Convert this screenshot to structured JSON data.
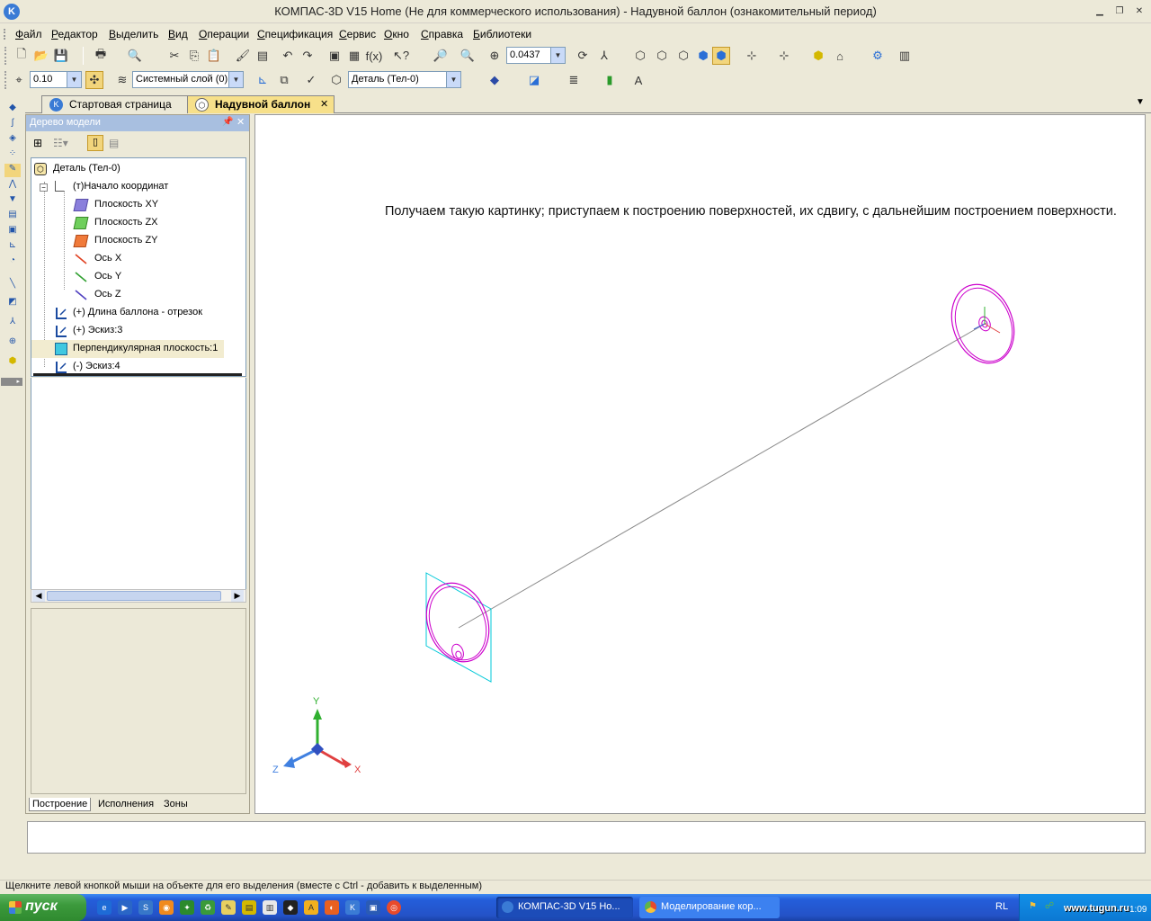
{
  "window": {
    "title": "КОМПАС-3D V15 Home (Не для коммерческого использования) - Надувной баллон (ознакомительный период)",
    "app_icon": "kompas-logo-icon"
  },
  "menu": [
    "Файл",
    "Редактор",
    "Выделить",
    "Вид",
    "Операции",
    "Спецификация",
    "Сервис",
    "Окно",
    "Справка",
    "Библиотеки"
  ],
  "toolbar": {
    "zoom_value": "0.0437",
    "step_value": "0.10",
    "layer_value": "Системный слой (0)",
    "detail_value": "Деталь (Тел-0)"
  },
  "tabs": [
    {
      "label": "Стартовая страница",
      "active": false
    },
    {
      "label": "Надувной баллон",
      "active": true
    }
  ],
  "tree_panel": {
    "title": "Дерево модели",
    "items": [
      {
        "label": "Деталь (Тел-0)",
        "icon": "part-icon"
      },
      {
        "label": "(т)Начало координат",
        "icon": "origin-icon"
      },
      {
        "label": "Плоскость XY",
        "icon": "plane-xy-icon"
      },
      {
        "label": "Плоскость ZX",
        "icon": "plane-zx-icon"
      },
      {
        "label": "Плоскость ZY",
        "icon": "plane-zy-icon"
      },
      {
        "label": "Ось X",
        "icon": "axis-x-icon"
      },
      {
        "label": "Ось Y",
        "icon": "axis-y-icon"
      },
      {
        "label": "Ось Z",
        "icon": "axis-z-icon"
      },
      {
        "label": "(+) Длина баллона - отрезок",
        "icon": "sketch-icon"
      },
      {
        "label": "(+) Эскиз:3",
        "icon": "sketch-icon"
      },
      {
        "label": "Перпендикулярная плоскость:1",
        "icon": "plane-icon"
      },
      {
        "label": "(-) Эскиз:4",
        "icon": "sketch-icon"
      }
    ],
    "bottom_tabs": [
      "Построение",
      "Исполнения",
      "Зоны"
    ]
  },
  "viewport": {
    "annotation": "Получаем такую картинку; приступаем к построению поверхностей, их сдвигу, с дальнейшим построением поверхности.",
    "axis_labels": {
      "x": "X",
      "y": "Y",
      "z": "Z"
    },
    "colors": {
      "sketch": "#cc00cc",
      "plane": "#00c8d8",
      "line": "#8a8a8a"
    }
  },
  "statusbar": {
    "text": "Щелкните левой кнопкой мыши на объекте для его выделения (вместе с Ctrl - добавить к выделенным)"
  },
  "taskbar": {
    "start_label": "пуск",
    "tasks": [
      {
        "label": "КОМПАС-3D V15 Ho...",
        "icon": "kompas-logo-icon"
      },
      {
        "label": "Моделирование кор...",
        "icon": "chrome-icon"
      }
    ],
    "lang": "RL",
    "clock": "1:09",
    "watermark": "www.tugun.ru"
  }
}
